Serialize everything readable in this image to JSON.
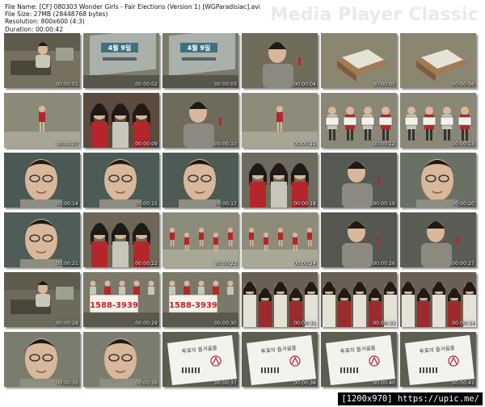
{
  "header": {
    "file_name": "File Name: [CF] 080303 Wonder Girls - Fair Elections (Version 1) [WGParadisiac].avi",
    "file_size": "File Size: 27MB (28448768 bytes)",
    "resolution": "Resolution: 800x600 (4:3)",
    "duration": "Duration: 00:00:42"
  },
  "brand": "Media Player Classic",
  "footer": "[1200x970] https://upic.me/",
  "thumbnails": [
    {
      "time": "00:00:01",
      "scene": "office",
      "tint": "#76715e"
    },
    {
      "time": "00:00:02",
      "scene": "monitor",
      "tint": "#7d7d6d"
    },
    {
      "time": "00:00:03",
      "scene": "monitor",
      "tint": "#7b7a6b"
    },
    {
      "time": "00:00:04",
      "scene": "man",
      "tint": "#6f6c5c"
    },
    {
      "time": "00:00:05",
      "scene": "box",
      "tint": "#8a8670"
    },
    {
      "time": "00:00:06",
      "scene": "box",
      "tint": "#8a8670"
    },
    {
      "time": "00:00:07",
      "scene": "girl",
      "tint": "#8b8a78"
    },
    {
      "time": "00:00:09",
      "scene": "girls",
      "tint": "#5b4a3d"
    },
    {
      "time": "00:00:10",
      "scene": "man",
      "tint": "#6e6b5b"
    },
    {
      "time": "00:00:11",
      "scene": "girl",
      "tint": "#8d8c7a"
    },
    {
      "time": "00:00:12",
      "scene": "signs",
      "tint": "#8a8776"
    },
    {
      "time": "00:00:13",
      "scene": "signs",
      "tint": "#8a8776"
    },
    {
      "time": "00:00:14",
      "scene": "face",
      "tint": "#4c5a55"
    },
    {
      "time": "00:00:15",
      "scene": "face",
      "tint": "#4d5b56"
    },
    {
      "time": "00:00:17",
      "scene": "face",
      "tint": "#4e5b55"
    },
    {
      "time": "00:00:18",
      "scene": "girls",
      "tint": "#6e6a5d"
    },
    {
      "time": "00:00:19",
      "scene": "man",
      "tint": "#565a52"
    },
    {
      "time": "00:00:20",
      "scene": "face",
      "tint": "#6b7064"
    },
    {
      "time": "00:00:21",
      "scene": "face",
      "tint": "#505c57"
    },
    {
      "time": "00:00:22",
      "scene": "girls",
      "tint": "#6d675a"
    },
    {
      "time": "00:00:23",
      "scene": "dance",
      "tint": "#8c8b79"
    },
    {
      "time": "00:00:24",
      "scene": "dance",
      "tint": "#8d8c7a"
    },
    {
      "time": "00:00:26",
      "scene": "man",
      "tint": "#54584f"
    },
    {
      "time": "00:00:27",
      "scene": "man",
      "tint": "#595d54"
    },
    {
      "time": "00:00:28",
      "scene": "office",
      "tint": "#6c6a5a"
    },
    {
      "time": "00:00:29",
      "scene": "banner",
      "tint": "#7a7868"
    },
    {
      "time": "00:00:30",
      "scene": "banner",
      "tint": "#7a7868"
    },
    {
      "time": "00:00:31",
      "scene": "group",
      "tint": "#6a5f54"
    },
    {
      "time": "00:00:33",
      "scene": "group",
      "tint": "#6a5f54"
    },
    {
      "time": "00:00:34",
      "scene": "group",
      "tint": "#6a5f54"
    },
    {
      "time": "00:00:35",
      "scene": "face",
      "tint": "#7a7c6d"
    },
    {
      "time": "00:00:36",
      "scene": "face",
      "tint": "#7b7d6e"
    },
    {
      "time": "00:00:37",
      "scene": "card",
      "tint": "#5d5d50"
    },
    {
      "time": "00:00:38",
      "scene": "card",
      "tint": "#5d5d50"
    },
    {
      "time": "00:00:40",
      "scene": "card",
      "tint": "#5d5d50"
    },
    {
      "time": "00:00:41",
      "scene": "card",
      "tint": "#5d5d50"
    }
  ]
}
